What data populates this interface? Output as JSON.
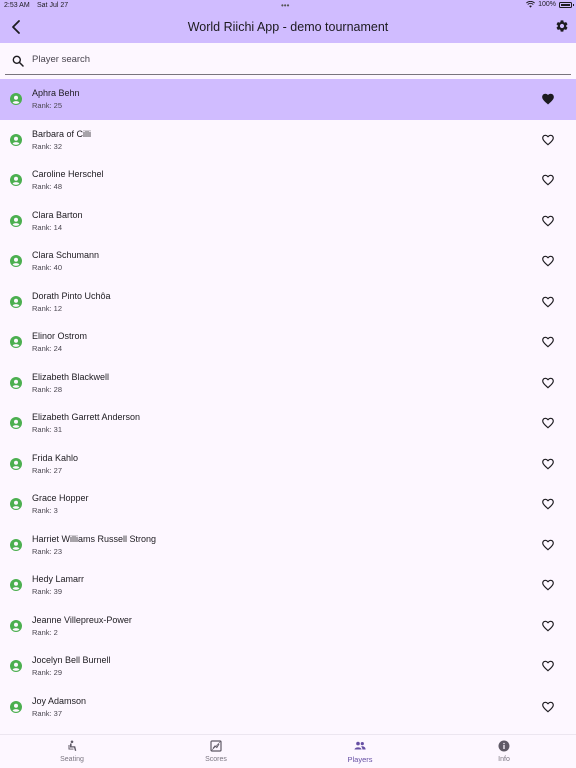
{
  "status_bar": {
    "time": "2:53 AM",
    "date": "Sat Jul 27",
    "battery": "100%"
  },
  "app_bar": {
    "title": "World Riichi App - demo tournament"
  },
  "search": {
    "placeholder": "Player search",
    "value": ""
  },
  "players": [
    {
      "name": "Aphra Behn",
      "rank": "Rank: 25",
      "favorite": true,
      "selected": true
    },
    {
      "name": "Barbara of Cilli",
      "rank": "Rank: 32",
      "favorite": false
    },
    {
      "name": "Caroline Herschel",
      "rank": "Rank: 48",
      "favorite": false
    },
    {
      "name": "Clara Barton",
      "rank": "Rank: 14",
      "favorite": false
    },
    {
      "name": "Clara Schumann",
      "rank": "Rank: 40",
      "favorite": false
    },
    {
      "name": "Dorath Pinto Uchôa",
      "rank": "Rank: 12",
      "favorite": false
    },
    {
      "name": "Elinor Ostrom",
      "rank": "Rank: 24",
      "favorite": false
    },
    {
      "name": "Elizabeth Blackwell",
      "rank": "Rank: 28",
      "favorite": false
    },
    {
      "name": "Elizabeth Garrett Anderson",
      "rank": "Rank: 31",
      "favorite": false
    },
    {
      "name": "Frida Kahlo",
      "rank": "Rank: 27",
      "favorite": false
    },
    {
      "name": "Grace Hopper",
      "rank": "Rank: 3",
      "favorite": false
    },
    {
      "name": "Harriet Williams Russell Strong",
      "rank": "Rank: 23",
      "favorite": false
    },
    {
      "name": "Hedy Lamarr",
      "rank": "Rank: 39",
      "favorite": false
    },
    {
      "name": "Jeanne Villepreux-Power",
      "rank": "Rank: 2",
      "favorite": false
    },
    {
      "name": "Jocelyn Bell Burnell",
      "rank": "Rank: 29",
      "favorite": false
    },
    {
      "name": "Joy Adamson",
      "rank": "Rank: 37",
      "favorite": false
    }
  ],
  "bottom_nav": [
    {
      "label": "Seating",
      "icon": "seat-icon",
      "active": false
    },
    {
      "label": "Scores",
      "icon": "scores-icon",
      "active": false
    },
    {
      "label": "Players",
      "icon": "people-icon",
      "active": true
    },
    {
      "label": "Info",
      "icon": "info-icon",
      "active": false
    }
  ],
  "colors": {
    "accent": "#d0bcff",
    "active_nav": "#6750a4",
    "avatar": "#4caf50",
    "background": "#fdf7ff"
  }
}
